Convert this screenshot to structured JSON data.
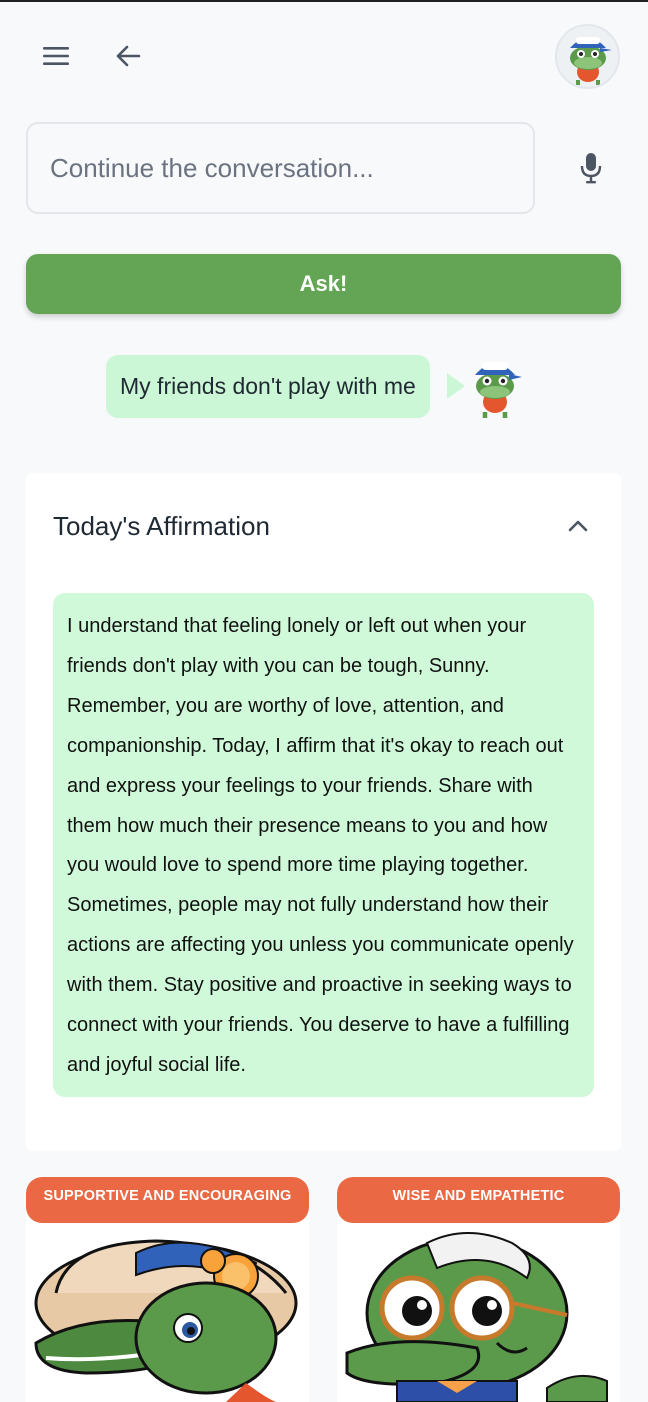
{
  "header": {
    "menu_icon": "hamburger-menu-icon",
    "back_icon": "arrow-left-icon",
    "avatar_icon": "user-gator-avatar-icon"
  },
  "input": {
    "placeholder": "Continue the conversation...",
    "value": "",
    "mic_icon": "microphone-icon"
  },
  "ask_button": {
    "label": "Ask!"
  },
  "user_message": {
    "text": "My friends don't play with me"
  },
  "affirmation": {
    "title": "Today's Affirmation",
    "collapse_icon": "chevron-up-icon",
    "body": "I understand that feeling lonely or left out when your friends don't play with you can be tough, Sunny. Remember, you are worthy of love, attention, and companionship. Today, I affirm that it's okay to reach out and express your feelings to your friends. Share with them how much their presence means to you and how you would love to spend more time playing together. Sometimes, people may not fully understand how their actions are affecting you unless you communicate openly with them. Stay positive and proactive in seeking ways to connect with your friends. You deserve to have a fulfilling and joyful social life."
  },
  "personas": [
    {
      "label": "SUPPORTIVE AND ENCOURAGING",
      "image_icon": "gator-sunhat-orange-icon"
    },
    {
      "label": "WISE AND EMPATHETIC",
      "image_icon": "gator-glasses-elder-icon"
    }
  ],
  "colors": {
    "accent_green": "#63a554",
    "bubble_green": "#ccf7d6",
    "tag_orange": "#ea6843",
    "background": "#f7f9fb"
  }
}
